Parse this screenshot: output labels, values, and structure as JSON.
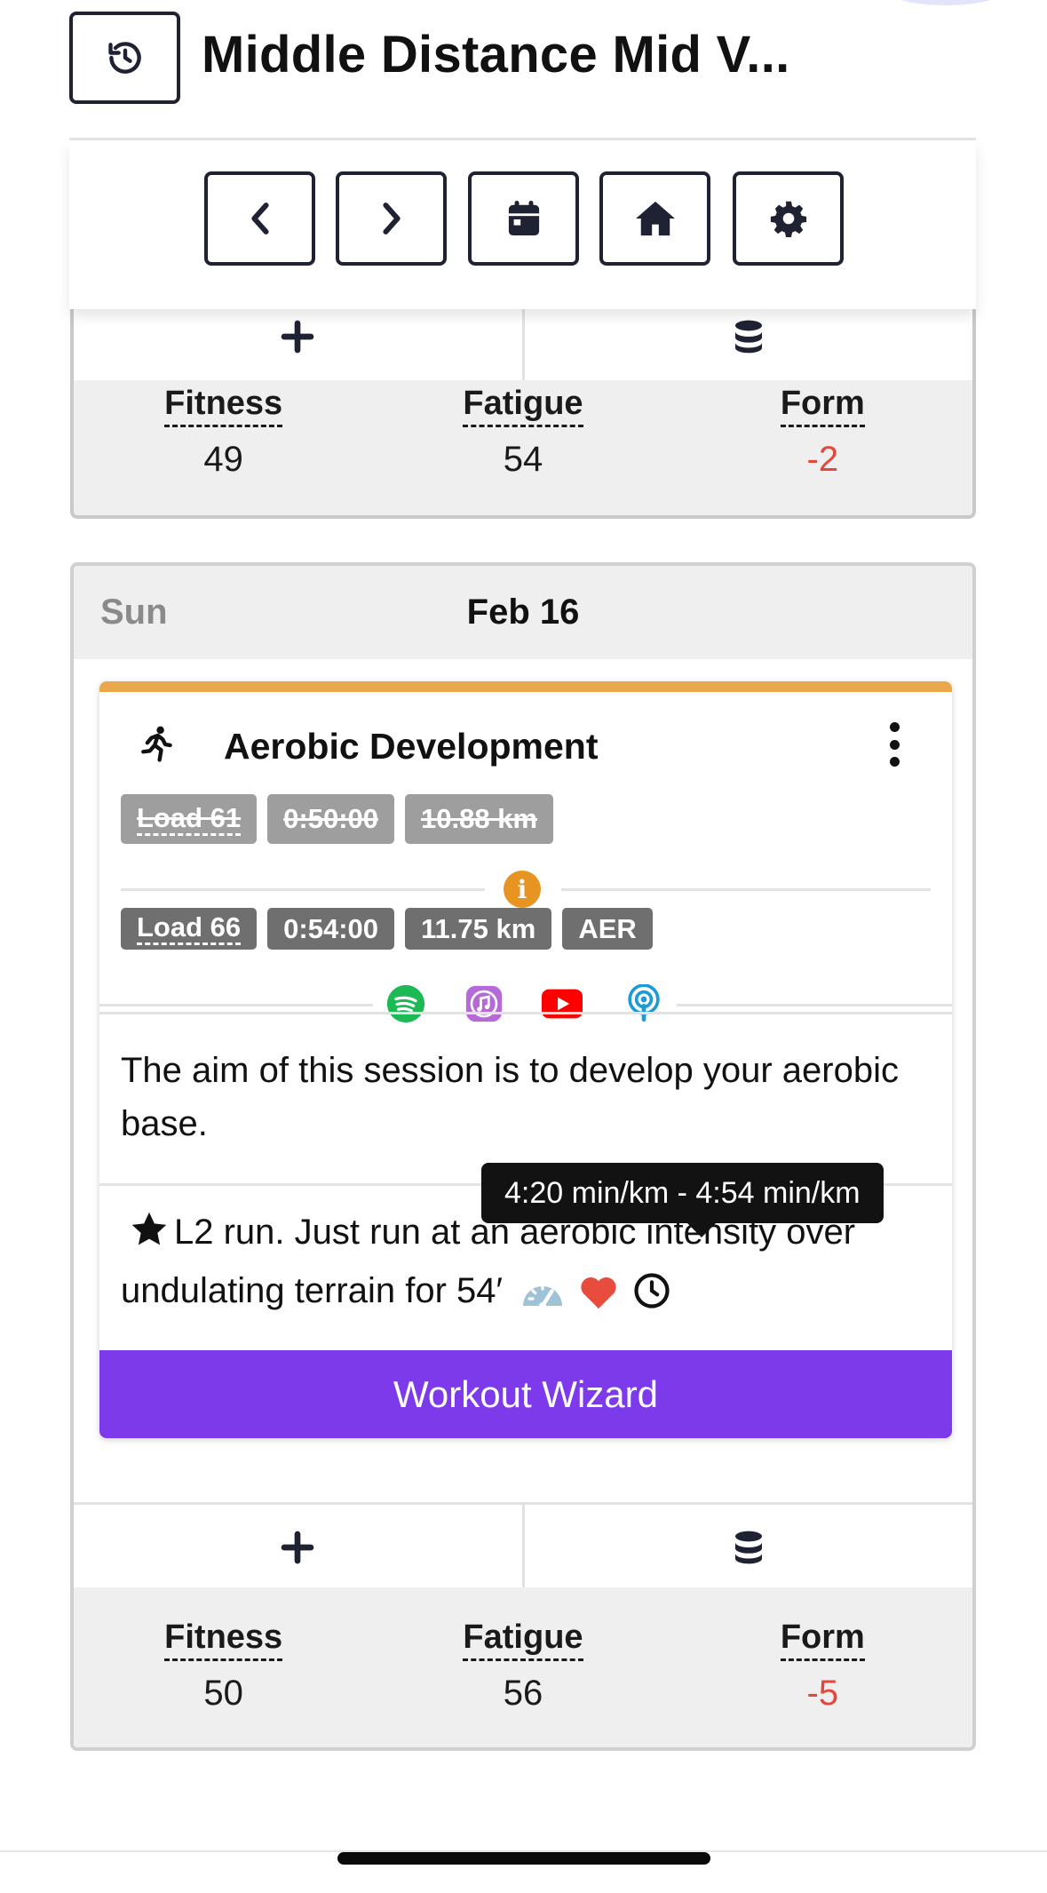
{
  "header": {
    "title": "Middle Distance Mid V..."
  },
  "toolbar": {
    "buttons": [
      "previous",
      "next",
      "calendar",
      "home",
      "settings"
    ]
  },
  "previous_day": {
    "metrics": [
      {
        "label": "Fitness",
        "value": "49"
      },
      {
        "label": "Fatigue",
        "value": "54"
      },
      {
        "label": "Form",
        "value": "-2"
      }
    ]
  },
  "day": {
    "weekday": "Sun",
    "date": "Feb 16",
    "workout": {
      "title": "Aerobic Development",
      "accent_color": "#e9a84b",
      "planned": {
        "load": "Load 61",
        "duration": "0:50:00",
        "distance": "10.88 km"
      },
      "actual": {
        "load": "Load 66",
        "duration": "0:54:00",
        "distance": "11.75 km",
        "zone": "AER"
      },
      "media_icons": [
        "spotify-icon",
        "itunes-icon",
        "youtube-icon",
        "podcast-icon"
      ],
      "description": "The aim of this session is to develop your aerobic base.",
      "instructions": "L2 run. Just run at an aerobic intensity over undulating terrain for 54′",
      "tooltip": "4:20 min/km - 4:54 min/km",
      "wizard_label": "Workout Wizard"
    },
    "metrics": [
      {
        "label": "Fitness",
        "value": "50"
      },
      {
        "label": "Fatigue",
        "value": "56"
      },
      {
        "label": "Form",
        "value": "-5"
      }
    ]
  }
}
